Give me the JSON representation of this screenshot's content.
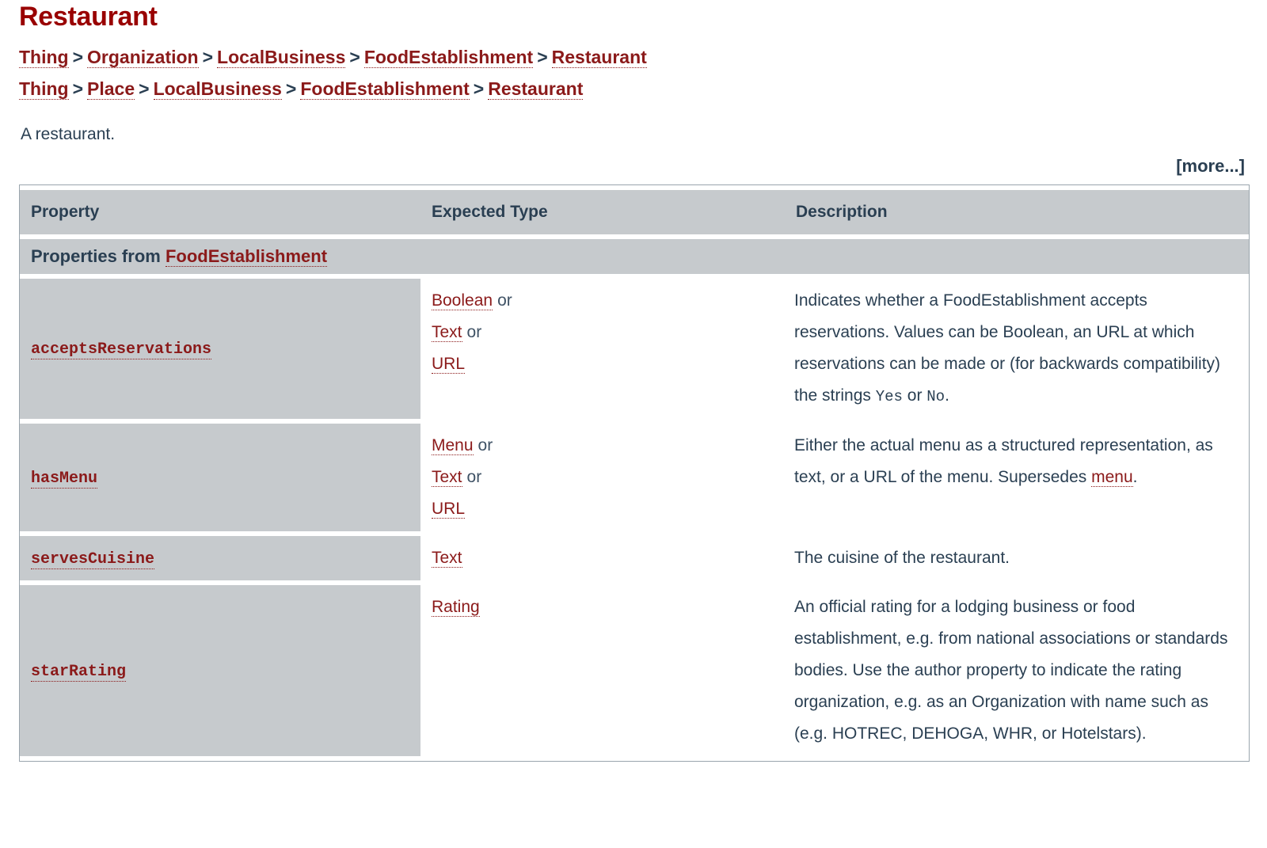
{
  "page": {
    "title": "Restaurant",
    "description": "A restaurant.",
    "more_label": "[more...]"
  },
  "breadcrumbs": [
    {
      "separator": ">",
      "items": [
        "Thing",
        "Organization",
        "LocalBusiness",
        "FoodEstablishment",
        "Restaurant"
      ]
    },
    {
      "separator": ">",
      "items": [
        "Thing",
        "Place",
        "LocalBusiness",
        "FoodEstablishment",
        "Restaurant"
      ]
    }
  ],
  "table": {
    "headers": {
      "property": "Property",
      "expected_type": "Expected Type",
      "description": "Description"
    },
    "section_label_prefix": "Properties from",
    "section_label_link": "FoodEstablishment",
    "rows": [
      {
        "property": "acceptsReservations",
        "types": [
          "Boolean",
          "Text",
          "URL"
        ],
        "or_label": "or",
        "description_parts": [
          {
            "kind": "text",
            "value": "Indicates whether a FoodEstablishment accepts reservations. Values can be Boolean, an URL at which reservations can be made or (for backwards compatibility) the strings "
          },
          {
            "kind": "code",
            "value": "Yes"
          },
          {
            "kind": "text",
            "value": " or "
          },
          {
            "kind": "code",
            "value": "No"
          },
          {
            "kind": "text",
            "value": "."
          }
        ]
      },
      {
        "property": "hasMenu",
        "types": [
          "Menu",
          "Text",
          "URL"
        ],
        "or_label": "or",
        "description_parts": [
          {
            "kind": "text",
            "value": "Either the actual menu as a structured representation, as text, or a URL of the menu. Supersedes "
          },
          {
            "kind": "link",
            "value": "menu"
          },
          {
            "kind": "text",
            "value": "."
          }
        ]
      },
      {
        "property": "servesCuisine",
        "types": [
          "Text"
        ],
        "or_label": "or",
        "description_parts": [
          {
            "kind": "text",
            "value": "The cuisine of the restaurant."
          }
        ]
      },
      {
        "property": "starRating",
        "types": [
          "Rating"
        ],
        "or_label": "or",
        "description_parts": [
          {
            "kind": "text",
            "value": "An official rating for a lodging business or food establishment, e.g. from national associations or standards bodies. Use the author property to indicate the rating organization, e.g. as an Organization with name such as (e.g. HOTREC, DEHOGA, WHR, or Hotelstars)."
          }
        ]
      }
    ]
  },
  "colors": {
    "link_red": "#8b1a1a",
    "title_red": "#990000",
    "text_slate": "#2a3f52",
    "cell_gray": "#c6cacd",
    "table_border": "#9aa5ad"
  }
}
